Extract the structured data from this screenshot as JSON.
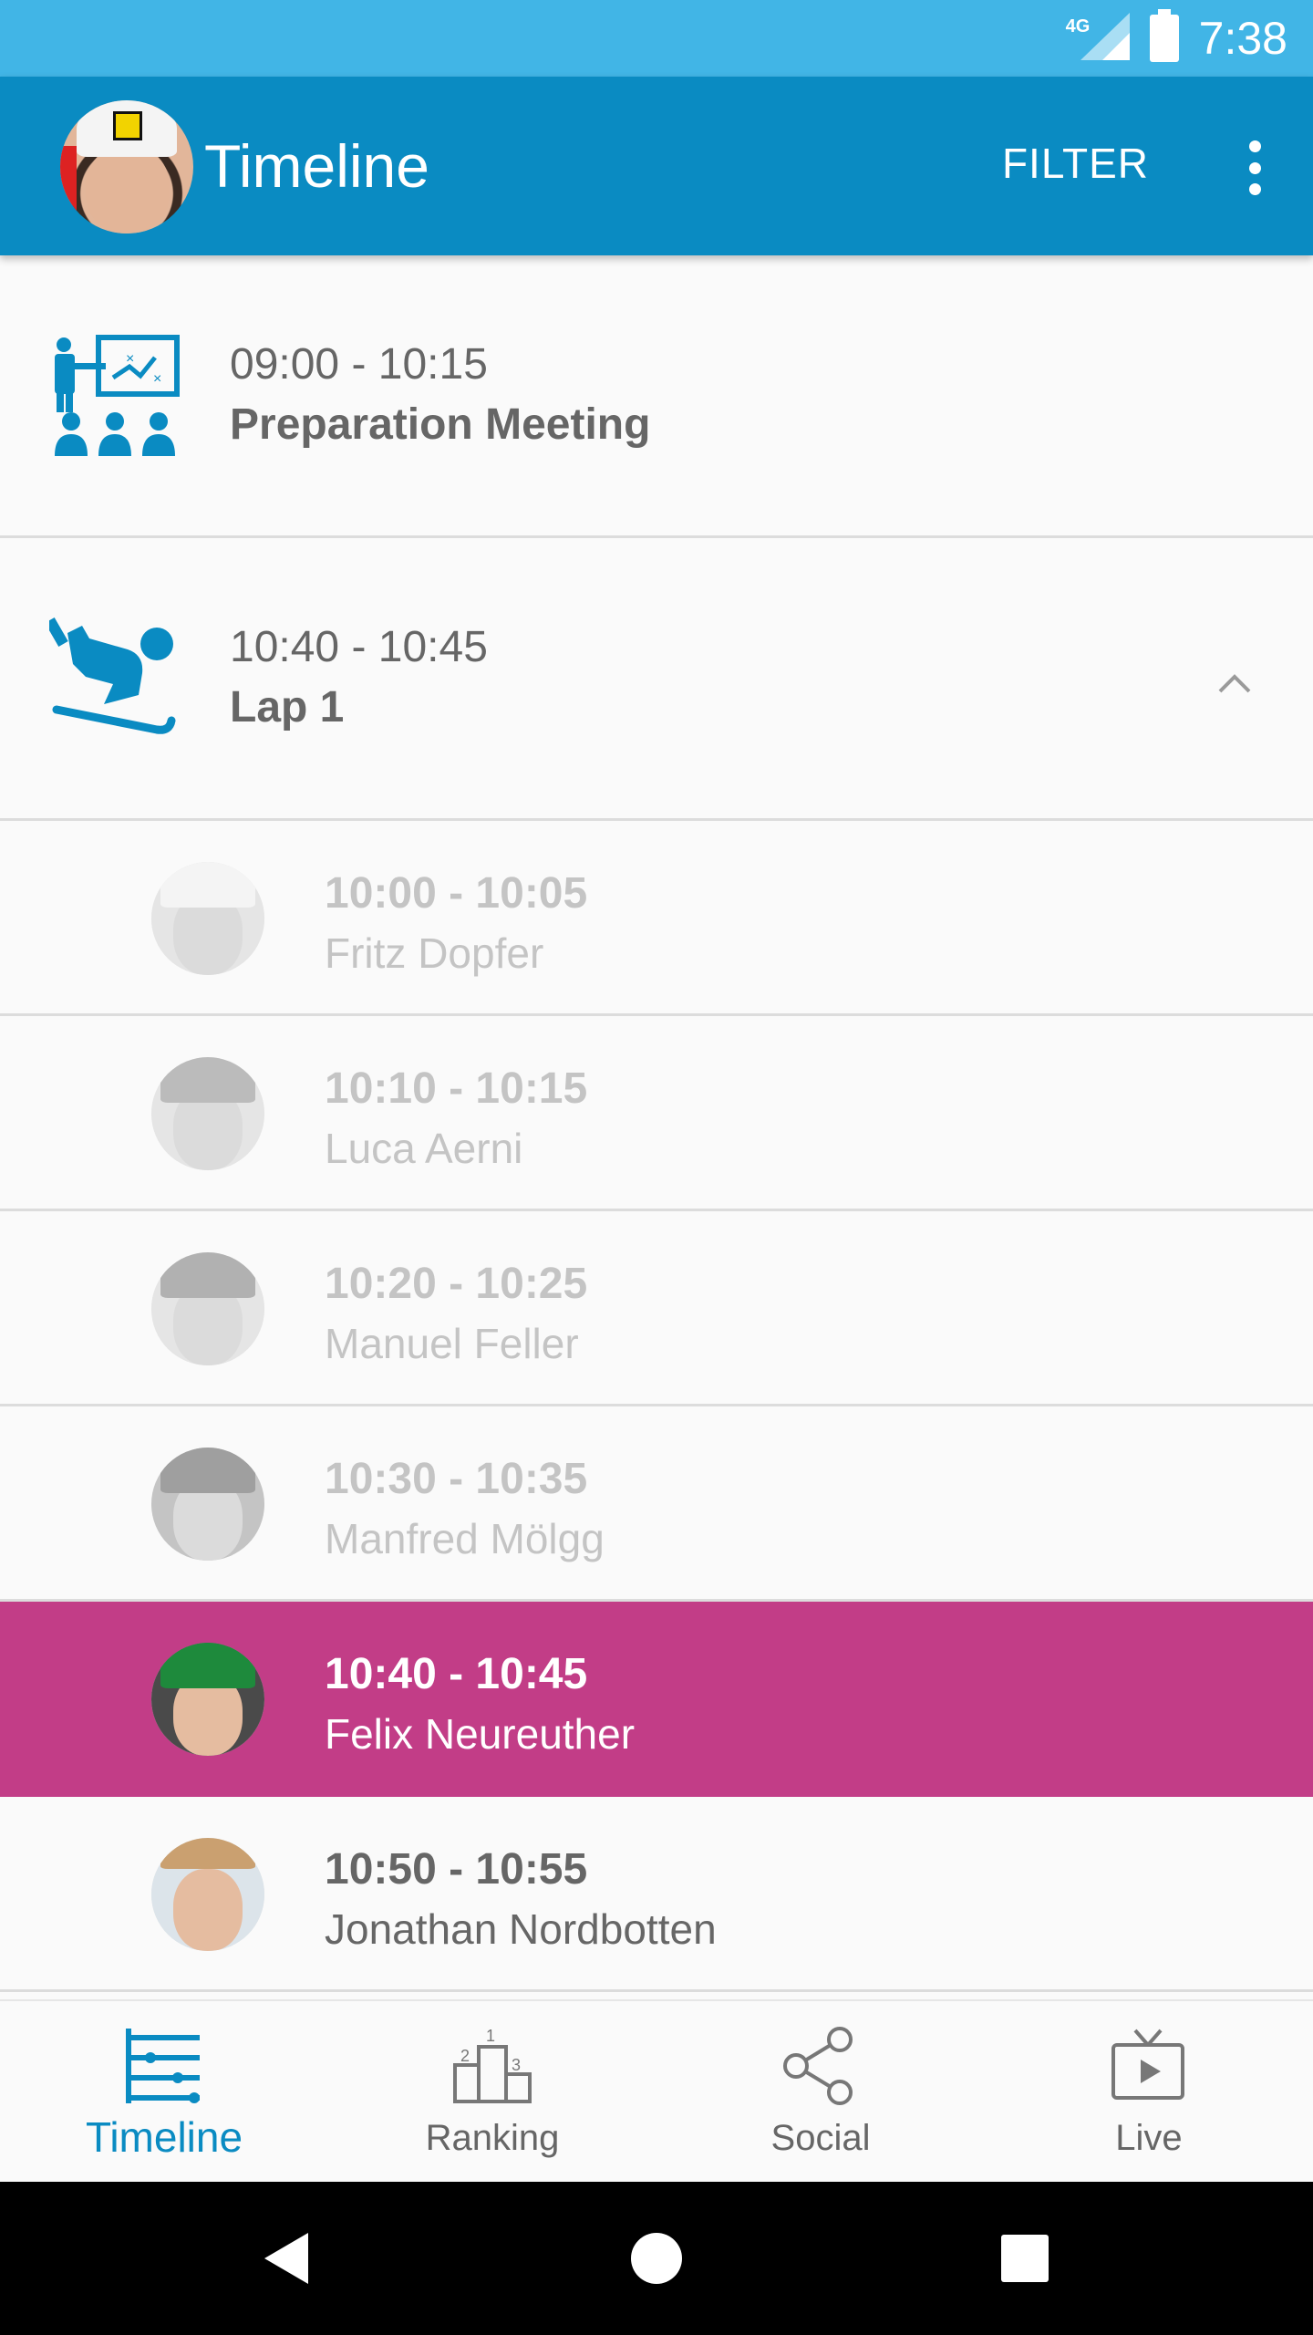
{
  "status_bar": {
    "network": "4G",
    "time": "7:38"
  },
  "app_bar": {
    "title": "Timeline",
    "filter_label": "FILTER"
  },
  "events": [
    {
      "time": "09:00 - 10:15",
      "title": "Preparation Meeting",
      "icon": "presentation-meeting-icon"
    },
    {
      "time": "10:40 - 10:45",
      "title": "Lap 1",
      "icon": "skier-icon",
      "expanded": true
    }
  ],
  "racers": [
    {
      "time": "10:00 - 10:05",
      "name": "Fritz Dopfer",
      "state": "past"
    },
    {
      "time": "10:10 - 10:15",
      "name": "Luca Aerni",
      "state": "past"
    },
    {
      "time": "10:20 - 10:25",
      "name": "Manuel Feller",
      "state": "past"
    },
    {
      "time": "10:30 - 10:35",
      "name": "Manfred Mölgg",
      "state": "past"
    },
    {
      "time": "10:40 - 10:45",
      "name": "Felix Neureuther",
      "state": "current"
    },
    {
      "time": "10:50 - 10:55",
      "name": "Jonathan Nordbotten",
      "state": "upcoming"
    }
  ],
  "bottom_nav": [
    {
      "label": "Timeline",
      "icon": "timeline-icon",
      "active": true
    },
    {
      "label": "Ranking",
      "icon": "podium-icon",
      "active": false
    },
    {
      "label": "Social",
      "icon": "share-icon",
      "active": false
    },
    {
      "label": "Live",
      "icon": "tv-play-icon",
      "active": false
    }
  ],
  "colors": {
    "primary": "#0a8bc2",
    "status_bar": "#41b5e6",
    "highlight": "#c23d87"
  }
}
